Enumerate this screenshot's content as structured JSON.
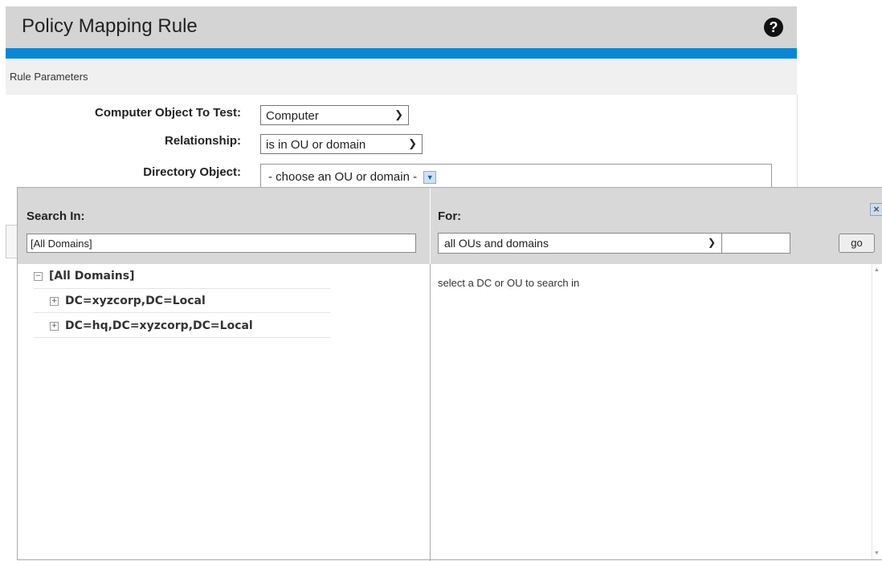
{
  "header": {
    "title": "Policy Mapping Rule",
    "help_icon": "question-circle-icon"
  },
  "section": {
    "label": "Rule Parameters"
  },
  "form": {
    "computer_object": {
      "label": "Computer Object To Test:",
      "value": "Computer"
    },
    "relationship": {
      "label": "Relationship:",
      "value": "is in OU or domain"
    },
    "directory_object": {
      "label": "Directory Object:",
      "value": "- choose an OU or domain -"
    }
  },
  "popup": {
    "search_in": {
      "label": "Search In:",
      "value": "[All Domains]"
    },
    "for": {
      "label": "For:",
      "value": "all OUs and domains",
      "text_value": ""
    },
    "go_label": "go",
    "tree": {
      "root": "[All Domains]",
      "children": [
        "DC=xyzcorp,DC=Local",
        "DC=hq,DC=xyzcorp,DC=Local"
      ]
    },
    "results_message": "select a DC or OU to search in"
  },
  "colors": {
    "accent": "#0a87d4",
    "header_bg": "#d4d4d4",
    "panel_bg": "#d8d8d8"
  }
}
